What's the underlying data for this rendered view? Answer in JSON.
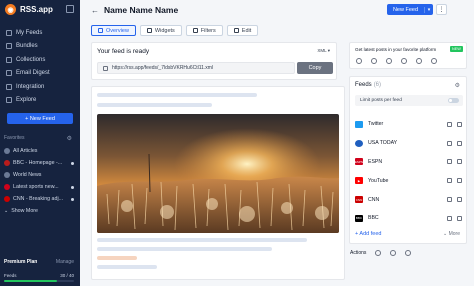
{
  "app": {
    "name": "RSS.app"
  },
  "nav": [
    {
      "label": "My Feeds"
    },
    {
      "label": "Bundles"
    },
    {
      "label": "Collections"
    },
    {
      "label": "Email Digest"
    },
    {
      "label": "Integration"
    },
    {
      "label": "Explore"
    }
  ],
  "sidebar": {
    "new_feed_label": "+  New Feed",
    "favorites_title": "Favorites",
    "favorites": [
      {
        "label": "All Articles",
        "dot": false
      },
      {
        "label": "BBC - Homepage -...",
        "dot": true
      },
      {
        "label": "World News",
        "dot": false
      },
      {
        "label": "Latest sports new...",
        "dot": true
      },
      {
        "label": "CNN - Breaking adj...",
        "dot": true
      },
      {
        "label": "Show More",
        "dot": false
      }
    ],
    "plan": {
      "title": "Premium Plan",
      "manage": "Manage",
      "feeds_label": "Feeds",
      "feeds_usage": "30 / 40",
      "usage_fraction": 0.75
    }
  },
  "header": {
    "back_icon": "←",
    "title": "Name Name Name",
    "new_feed_label": "New Feed",
    "more_icon": "⋮"
  },
  "tabs": [
    {
      "label": "Overview",
      "active": true
    },
    {
      "label": "Widgets",
      "active": false
    },
    {
      "label": "Filters",
      "active": false
    },
    {
      "label": "Edit",
      "active": false
    }
  ],
  "ready": {
    "title": "Your feed is ready",
    "format": "XML ▾",
    "url": "https://rss.app/feeds/_7ldsbVKRHu6Ctl11.xml",
    "copy_label": "Copy"
  },
  "promo": {
    "text": "Get latest posts in your favorite platform",
    "badge": "NEW"
  },
  "feeds": {
    "title": "Feeds",
    "count": "(6)",
    "limit_label": "Limit posts per feed",
    "items": [
      {
        "name": "Twitter",
        "logo_color": "#1d9bf0",
        "logo_text": ""
      },
      {
        "name": "USA TODAY",
        "logo_color": "#1f5fbf",
        "logo_text": ""
      },
      {
        "name": "ESPN",
        "logo_color": "#d0021b",
        "logo_text": "ESPN"
      },
      {
        "name": "YouTube",
        "logo_color": "#ff0000",
        "logo_text": "▶"
      },
      {
        "name": "CNN",
        "logo_color": "#cc0000",
        "logo_text": "CNN"
      },
      {
        "name": "BBC",
        "logo_color": "#000000",
        "logo_text": "BBC"
      }
    ],
    "add_label": "+ Add feed",
    "more_label": "⌄ More"
  },
  "actions_label": "Actions"
}
